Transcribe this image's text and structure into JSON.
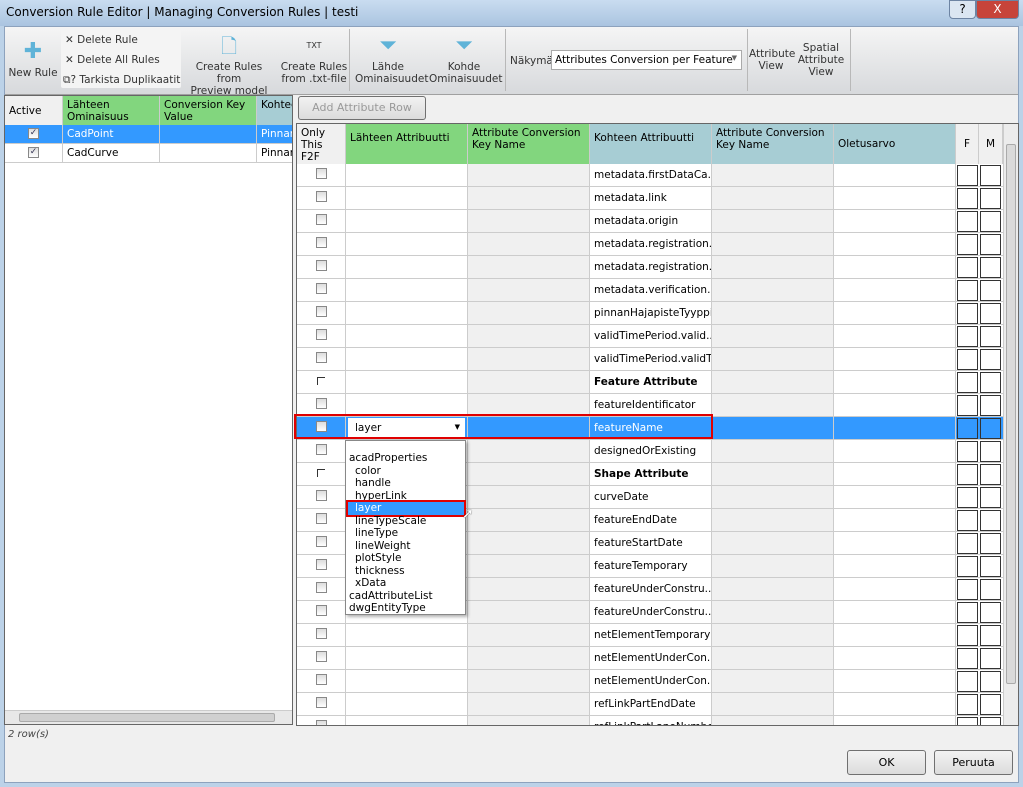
{
  "window": {
    "title": "Conversion Rule Editor | Managing Conversion Rules | testi",
    "help": "?",
    "close": "X"
  },
  "toolbar": {
    "new_rule": "New Rule",
    "delete_rule": "Delete Rule",
    "delete_all": "Delete All Rules",
    "check_duplicates": "Tarkista Duplikaatit",
    "create_preview": [
      "Create Rules from",
      "Preview model"
    ],
    "create_txt": [
      "Create Rules",
      "from .txt-file"
    ],
    "txt_badge": "TXT",
    "lahde": [
      "Lähde",
      "Ominaisuudet"
    ],
    "kohde": [
      "Kohde",
      "Ominaisuudet"
    ],
    "view_label": "Näkymä",
    "view_value": "Attributes Conversion per Feature",
    "attribute_view": [
      "Attribute",
      "View"
    ],
    "spatial_view": [
      "Spatial",
      "Attribute",
      "View"
    ]
  },
  "left_grid": {
    "headers": [
      "Active",
      "Lähteen Ominaisuus",
      "Conversion Key Value",
      "Kohteen ominaisuus"
    ],
    "rows": [
      {
        "active": true,
        "source": "CadPoint",
        "key": "",
        "target": "Pinnan",
        "selected": true
      },
      {
        "active": true,
        "source": "CadCurve",
        "key": "",
        "target": "Pinnan",
        "selected": false
      }
    ],
    "status": "2 row(s)"
  },
  "right_grid": {
    "add_row": "Add Attribute Row",
    "headers": [
      "Only This F2F",
      "Lähteen Attribuutti",
      "Attribute Conversion Key Name",
      "Kohteen Attribuutti",
      "Attribute Conversion Key Name",
      "Oletusarvo",
      "F",
      "M"
    ],
    "rows": [
      {
        "t": "metadata.firstDataCa..."
      },
      {
        "t": "metadata.link"
      },
      {
        "t": "metadata.origin"
      },
      {
        "t": "metadata.registration..."
      },
      {
        "t": "metadata.registration..."
      },
      {
        "t": "metadata.verification..."
      },
      {
        "t": "pinnanHajapisteTyyppi"
      },
      {
        "t": "validTimePeriod.valid..."
      },
      {
        "t": "validTimePeriod.validTo"
      },
      {
        "t": "Feature Attribute",
        "bold": true
      },
      {
        "t": "featureIdentificator"
      },
      {
        "t": "featureName",
        "selected": true,
        "source": "layer"
      },
      {
        "t": "designedOrExisting"
      },
      {
        "t": "Shape Attribute",
        "bold": true
      },
      {
        "t": "curveDate"
      },
      {
        "t": "featureEndDate"
      },
      {
        "t": "featureStartDate"
      },
      {
        "t": "featureTemporary"
      },
      {
        "t": "featureUnderConstru..."
      },
      {
        "t": "featureUnderConstru..."
      },
      {
        "t": "netElementTemporary"
      },
      {
        "t": "netElementUnderCon..."
      },
      {
        "t": "netElementUnderCon..."
      },
      {
        "t": "refLinkPartEndDate"
      },
      {
        "t": "refLinkPartLaneNumber"
      }
    ]
  },
  "dropdown": {
    "items": [
      {
        "l": "acadProperties",
        "i": 0
      },
      {
        "l": "color",
        "i": 1
      },
      {
        "l": "handle",
        "i": 1
      },
      {
        "l": "hyperLink",
        "i": 1
      },
      {
        "l": "layer",
        "i": 1,
        "selected": true
      },
      {
        "l": "lineTypeScale",
        "i": 1
      },
      {
        "l": "lineType",
        "i": 1
      },
      {
        "l": "lineWeight",
        "i": 1
      },
      {
        "l": "plotStyle",
        "i": 1
      },
      {
        "l": "thickness",
        "i": 1
      },
      {
        "l": "xData",
        "i": 1
      },
      {
        "l": "cadAttributeList",
        "i": 0
      },
      {
        "l": "dwgEntityType",
        "i": 0
      }
    ]
  },
  "footer": {
    "ok": "OK",
    "cancel": "Peruuta"
  },
  "colors": {
    "selection": "#3399ff",
    "source_header": "#82d67e",
    "target_header": "#a7cdd4",
    "highlight": "#e00000"
  }
}
